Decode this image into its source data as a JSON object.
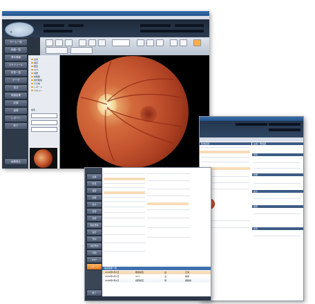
{
  "viewer": {
    "nav_buttons": [
      "ホーム一覧",
      "検査一覧",
      "基本情報",
      "スケジュール",
      "所見一覧",
      "データ",
      "書式",
      "検査結果",
      "記録",
      "画像",
      "レポート",
      "終了"
    ],
    "tree_items": [
      "患者",
      "検査",
      "眼底",
      "OCT",
      "視野",
      "前眼部",
      "蛍光眼底",
      "その他",
      "レポート",
      "スキャン"
    ],
    "search_label": "検索",
    "bottom_button": "画像取込"
  },
  "record_back": {
    "title": "診療記録",
    "section_1": "主訴・現病歴",
    "section_2": "所見",
    "section_3": "診断",
    "section_4": "処方",
    "section_5": "検査",
    "section_6": "処置"
  },
  "record_front": {
    "nav_buttons": [
      "主訴",
      "所見",
      "検査",
      "画像",
      "処方",
      "処置",
      "診断",
      "病名登録",
      "会計",
      "予約",
      "次回予約",
      "印刷",
      "MWT",
      "レポート",
      "終了"
    ],
    "table_title": "検査結果一覧",
    "table_rows": [
      [
        "2006年5月6日",
        "眼底検査",
        "右",
        "正常"
      ],
      [
        "2006年5月6日",
        "OCT",
        "左",
        "異常"
      ],
      [
        "2006年5月6日",
        "視野検査",
        "両",
        "要観察"
      ]
    ]
  },
  "colors": {
    "accent": "#3d6fae",
    "highlight_row": "#f7dcb8",
    "nav_hot": "#e07a20",
    "dark_panel": "#2f3a48"
  }
}
